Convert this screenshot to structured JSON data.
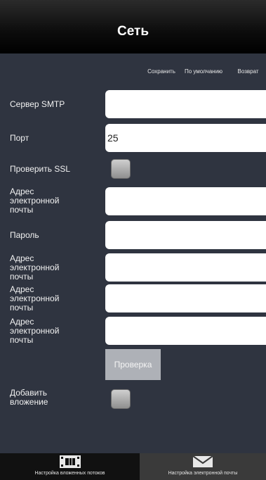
{
  "header": {
    "title": "Сеть"
  },
  "actions": {
    "save_label": "Сохранить",
    "default_label": "По умолчанию",
    "back_label": "Возврат"
  },
  "form": {
    "smtp_label": "Сервер SMTP",
    "smtp_value": "",
    "port_label": "Порт",
    "port_value": "25",
    "ssl_label": "Проверить SSL",
    "email1_label": "Адрес электронной почты",
    "email1_value": "",
    "password_label": "Пароль",
    "password_value": "",
    "email2_label": "Адрес электронной почты",
    "email2_value": "",
    "email3_label": "Адрес электронной почты",
    "email3_value": "",
    "email4_label": "Адрес электронной почты",
    "email4_value": "",
    "test_button_label": "Проверка",
    "attach_label": "Добавить вложение"
  },
  "tabs": [
    {
      "label": "Настройка вложенных потоков",
      "icon": "film-icon"
    },
    {
      "label": "Настройка электронной почты",
      "icon": "envelope-icon"
    }
  ],
  "colors": {
    "background": "#2f3440",
    "header": "#000000",
    "field": "#ffffff",
    "test_button": "#aeb1b7",
    "active_tab": "#3a3a3a"
  }
}
